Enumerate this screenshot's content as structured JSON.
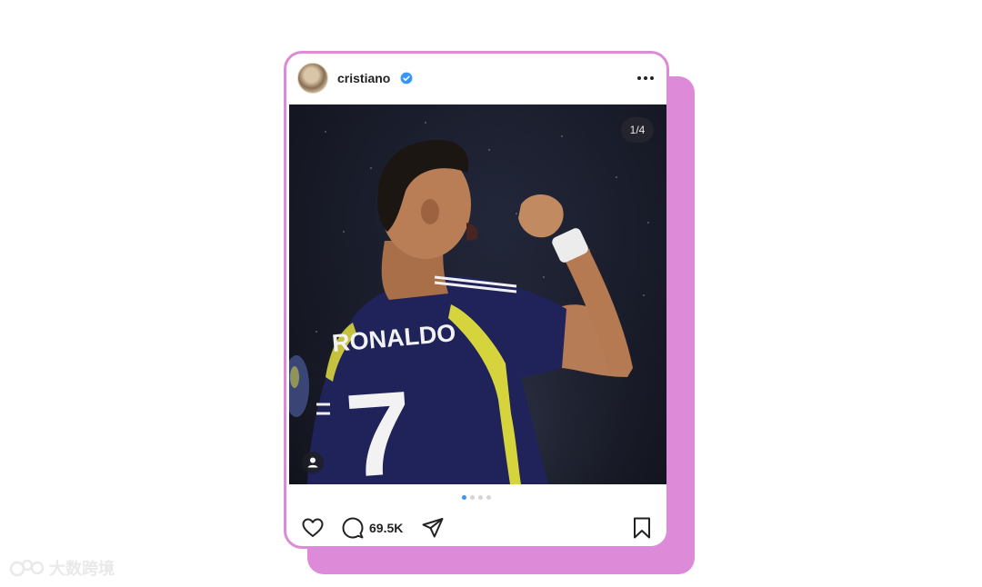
{
  "post": {
    "username": "cristiano",
    "verified": true,
    "photo": {
      "counter": "1/4",
      "jersey_name": "RONALDO",
      "jersey_number": "7",
      "slide_index": 1,
      "slide_total": 4
    },
    "actions": {
      "comment_count": "69.5K"
    }
  },
  "colors": {
    "accent_pink": "#dd8ad8",
    "verified_blue": "#3897f0",
    "active_dot": "#3897f0"
  },
  "icons": [
    "verified-badge-icon",
    "more-options-icon",
    "heart-icon",
    "comment-icon",
    "share-icon",
    "bookmark-icon",
    "user-tag-icon"
  ],
  "watermark": {
    "text": "大数跨境"
  }
}
